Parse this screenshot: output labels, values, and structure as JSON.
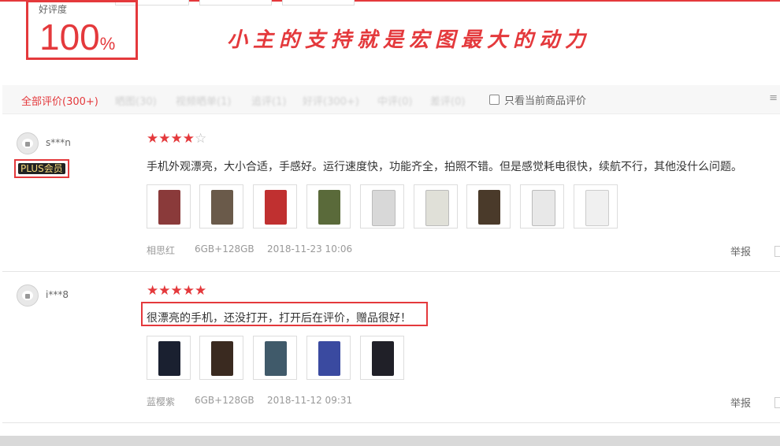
{
  "rating": {
    "label": "好评度",
    "value": "100",
    "unit": "%"
  },
  "slogan": "小主的支持就是宏图最大的动力",
  "filters": {
    "all": "全部评价(300+)",
    "hidden": [
      "晒图(30)",
      "视频晒单(1)",
      "追评(1)",
      "好评(300+)",
      "中评(0)",
      "差评(0)"
    ],
    "only_current_label": "只看当前商品评价",
    "more": "≡"
  },
  "reviews": [
    {
      "username": "s***n",
      "badge": "PLUS会员",
      "stars": 4,
      "max_stars": 5,
      "text": "手机外观漂亮，大小合适，手感好。运行速度快，功能齐全，拍照不错。但是感觉耗电很快，续航不行，其他没什么问题。",
      "color": "相思红",
      "spec": "6GB+128GB",
      "date": "2018-11-23 10:06",
      "report": "举报",
      "photo_colors": [
        "#8a3a3a",
        "#6a5a4a",
        "#c03030",
        "#5a6a3a",
        "#d8d8d8",
        "#e0e0d8",
        "#4a3a2a",
        "#e8e8e8",
        "#f0f0f0"
      ]
    },
    {
      "username": "i***8",
      "badge": "",
      "stars": 5,
      "max_stars": 5,
      "text": "很漂亮的手机，还没打开，打开后在评价，赠品很好！",
      "color": "蓝樱紫",
      "spec": "6GB+128GB",
      "date": "2018-11-12 09:31",
      "report": "举报",
      "photo_colors": [
        "#1a2030",
        "#3a2a20",
        "#405a6a",
        "#3a4aa0",
        "#202028"
      ]
    }
  ],
  "colors": {
    "accent": "#e4393c",
    "badge_bg": "#222222",
    "badge_text": "#f5d87a"
  }
}
